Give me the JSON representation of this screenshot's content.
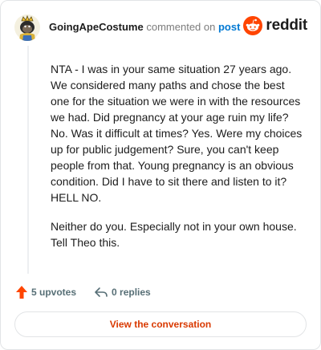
{
  "header": {
    "author": "GoingApeCostume",
    "action": "commented on",
    "post_link": "post",
    "brand": "reddit"
  },
  "comment": {
    "paragraphs": [
      "NTA - I was in your same situation 27 years ago. We considered many paths and chose the best one for the situation we were in with the resources we had. Did pregnancy at your age ruin my life? No. Was it difficult at times? Yes. Were my choices up for public judgement? Sure, you can't keep people from that. Young pregnancy is an obvious condition. Did I have to sit there and listen to it? HELL NO.",
      "Neither do you. Especially not in your own house. Tell Theo this."
    ]
  },
  "footer": {
    "upvotes": "5 upvotes",
    "replies": "0 replies",
    "view_button": "View the conversation"
  },
  "icons": {
    "upvote": "upvote-arrow-icon",
    "reply": "reply-arrow-icon",
    "brand_logo": "reddit-snoo-icon",
    "avatar": "gorilla-costume-avatar"
  },
  "colors": {
    "upvote": "#ff4500",
    "brand": "#ff4500",
    "post_link": "#0079d3",
    "button_text": "#d93900",
    "muted": "#576f76"
  }
}
